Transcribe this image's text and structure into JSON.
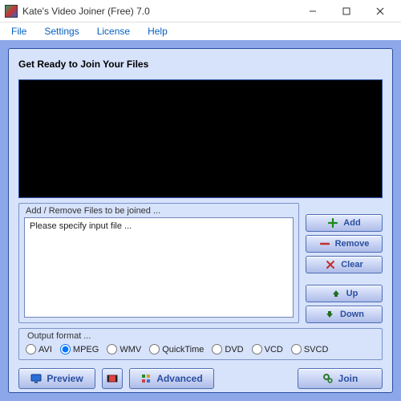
{
  "window": {
    "title": "Kate's Video Joiner (Free) 7.0"
  },
  "menu": {
    "file": "File",
    "settings": "Settings",
    "license": "License",
    "help": "Help"
  },
  "panel": {
    "title": "Get Ready to Join Your Files"
  },
  "filegroup": {
    "label": "Add / Remove Files to be joined ...",
    "placeholder": "Please specify input file ..."
  },
  "buttons": {
    "add": "Add",
    "remove": "Remove",
    "clear": "Clear",
    "up": "Up",
    "down": "Down",
    "preview": "Preview",
    "advanced": "Advanced",
    "join": "Join"
  },
  "format": {
    "label": "Output format ...",
    "options": {
      "avi": "AVI",
      "mpeg": "MPEG",
      "wmv": "WMV",
      "quicktime": "QuickTime",
      "dvd": "DVD",
      "vcd": "VCD",
      "svcd": "SVCD"
    },
    "selected": "mpeg"
  }
}
